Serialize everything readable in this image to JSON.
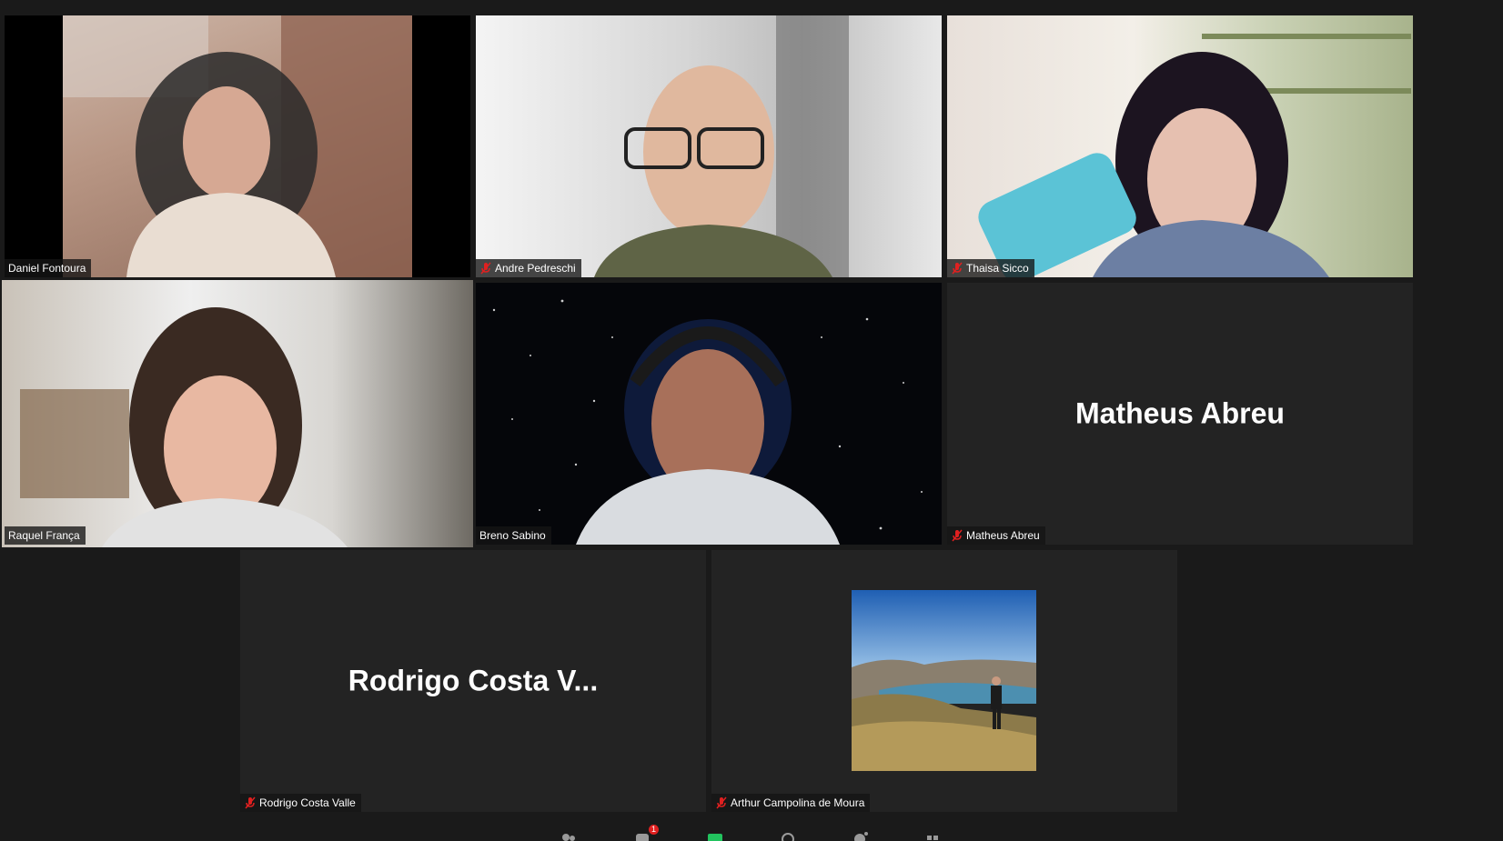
{
  "participants": [
    {
      "name": "Daniel Fontoura",
      "muted": false,
      "video": true
    },
    {
      "name": "Andre Pedreschi",
      "muted": true,
      "video": true
    },
    {
      "name": "Thaisa Sicco",
      "muted": true,
      "video": true
    },
    {
      "name": "Raquel França",
      "muted": false,
      "video": true,
      "active_speaker": true
    },
    {
      "name": "Breno Sabino",
      "muted": false,
      "video": true
    },
    {
      "name": "Matheus Abreu",
      "muted": true,
      "video": false,
      "display_name": "Matheus Abreu"
    },
    {
      "name": "Rodrigo Costa Valle",
      "muted": true,
      "video": false,
      "display_name": "Rodrigo Costa V..."
    },
    {
      "name": "Arthur Campolina de Moura",
      "muted": true,
      "video": false,
      "profile_photo": true
    }
  ],
  "toolbar": {
    "chat_badge": "1"
  },
  "colors": {
    "active_speaker_border": "#c6e04a",
    "muted_icon": "#e02020",
    "tile_bg": "#232323",
    "page_bg": "#1a1a1a"
  }
}
